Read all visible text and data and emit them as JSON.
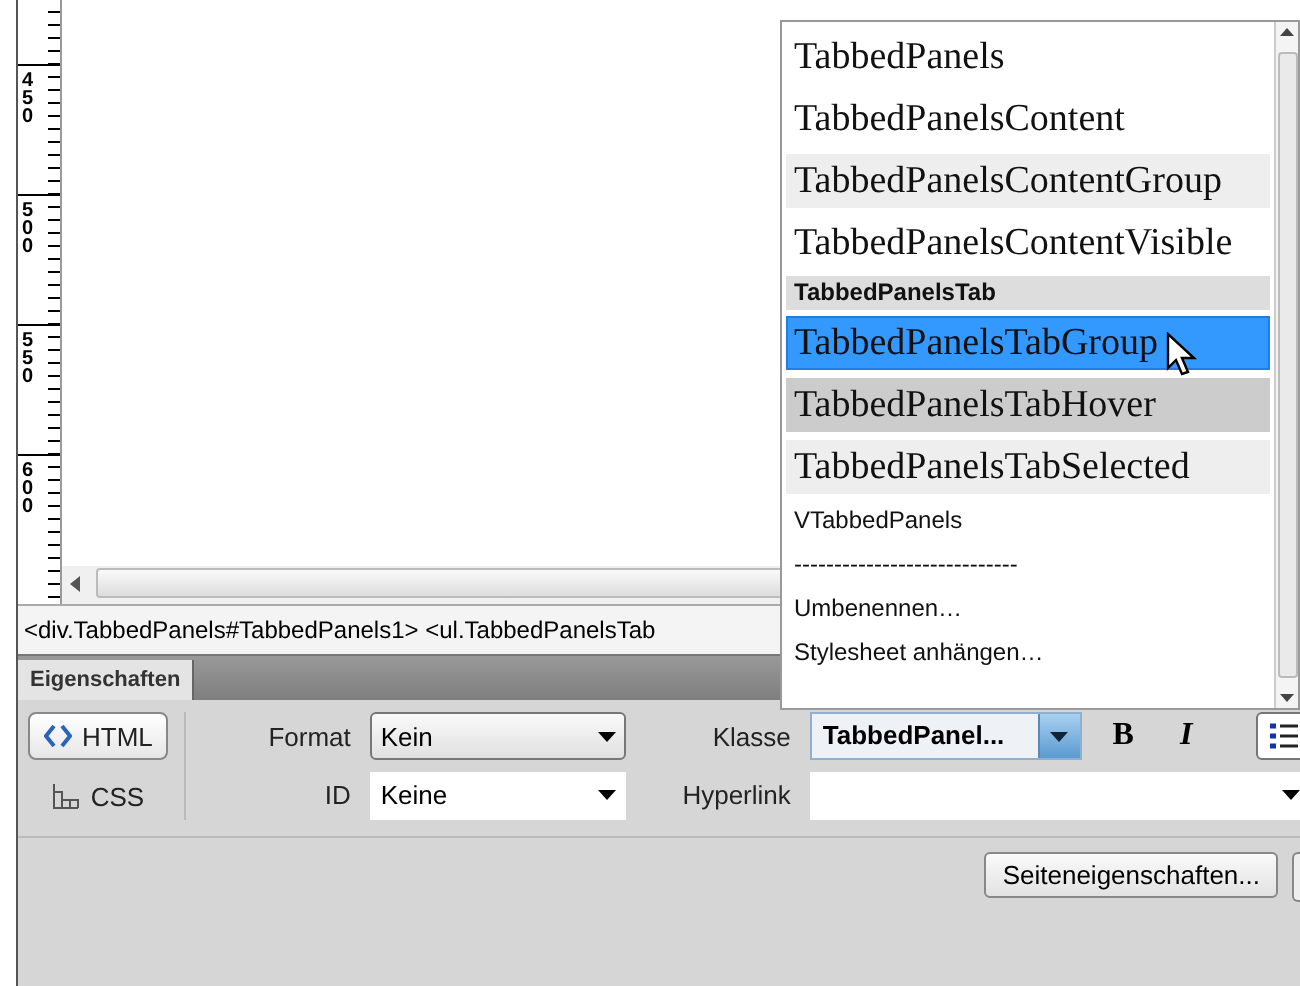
{
  "ruler": {
    "labels": [
      "450",
      "500",
      "550",
      "600"
    ]
  },
  "tag_bar": {
    "path": "<div.TabbedPanels#TabbedPanels1> <ul.TabbedPanelsTab"
  },
  "properties": {
    "tab": {
      "label": "Eigenschaften",
      "selected": true
    },
    "modes": [
      {
        "label": "HTML",
        "kind": "code",
        "selected": true
      },
      {
        "label": "CSS",
        "kind": "css",
        "selected": false
      }
    ],
    "format": {
      "label": "Format",
      "value": "Kein"
    },
    "id": {
      "label": "ID",
      "value": "Keine"
    },
    "klasse": {
      "label": "Klasse",
      "value": "TabbedPanel..."
    },
    "hyperlink": {
      "label": "Hyperlink"
    },
    "bold_button": "B",
    "italic_button": "I",
    "page_button": "Seiteneigenschaften..."
  },
  "class_menu": {
    "items": [
      {
        "label": "TabbedPanels",
        "kind": "styled",
        "color": "#ffffff",
        "selected": false
      },
      {
        "label": "TabbedPanelsContent",
        "kind": "styled",
        "color": "#ffffff",
        "selected": false
      },
      {
        "label": "TabbedPanelsContentGroup",
        "kind": "styled",
        "color": "#eeeeee",
        "selected": false
      },
      {
        "label": "TabbedPanelsContentVisible",
        "kind": "styled",
        "color": "#ffffff",
        "selected": false
      },
      {
        "label": "TabbedPanelsTab",
        "kind": "heading",
        "color": "#dddddd",
        "selected": false
      },
      {
        "label": "TabbedPanelsTabGroup",
        "kind": "styled",
        "color": "#3399ff",
        "selected": true
      },
      {
        "label": "TabbedPanelsTabHover",
        "kind": "styled",
        "color": "#cccccc",
        "selected": false
      },
      {
        "label": "TabbedPanelsTabSelected",
        "kind": "styled",
        "color": "#eeeeee",
        "selected": false
      },
      {
        "label": "VTabbedPanels",
        "kind": "plain",
        "color": "#ffffff",
        "selected": false
      },
      {
        "label": "----------------------------",
        "kind": "separator",
        "color": "#ffffff",
        "selected": false
      },
      {
        "label": "Umbenennen…",
        "kind": "plain",
        "color": "#ffffff",
        "selected": false
      },
      {
        "label": "Stylesheet anhängen…",
        "kind": "plain",
        "color": "#ffffff",
        "selected": false
      }
    ]
  }
}
